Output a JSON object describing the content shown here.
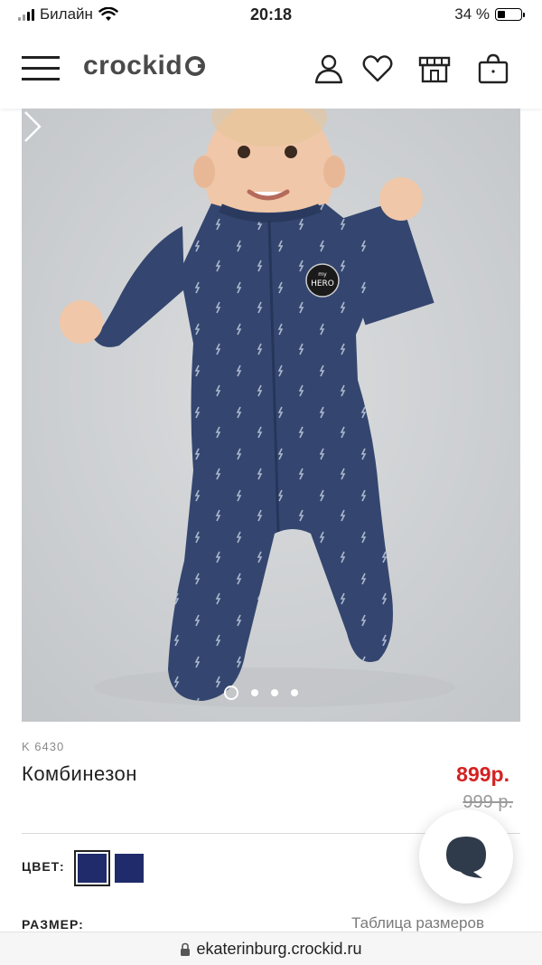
{
  "status_bar": {
    "carrier": "Билайн",
    "time": "20:18",
    "battery": "34 %",
    "battery_level": 0.34
  },
  "header": {
    "logo": "crockid"
  },
  "gallery": {
    "slide_count": 4,
    "active_slide": 1,
    "badge_text": [
      "my",
      "HERO"
    ]
  },
  "product": {
    "sku": "K 6430",
    "name": "Комбинезон",
    "price": "899р.",
    "old_price": "999 р."
  },
  "options": {
    "color_label": "ЦВЕТ:",
    "colors": [
      "#1f2b6a",
      "#1f2b6a"
    ],
    "size_label": "РАЗМЕР:",
    "size_table_link": "Таблица размеров"
  },
  "browser": {
    "url": "ekaterinburg.crockid.ru"
  },
  "colors": {
    "accent_price": "#d42222",
    "suit": "#34466f",
    "background": "#d0d3d6"
  }
}
